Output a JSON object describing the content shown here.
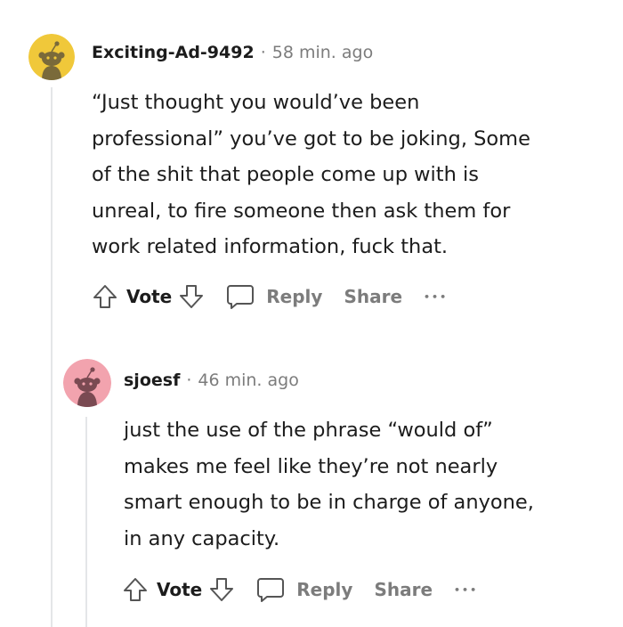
{
  "comments": [
    {
      "username": "Exciting-Ad-9492",
      "separator": "·",
      "time": "58 min. ago",
      "avatar_color": "#f0c83a",
      "body": "“Just thought you would’ve been\nprofessional” you’ve got to be joking, Some\nof the shit that people come up with is\nunreal, to fire someone then ask them for\nwork related information, fuck that.",
      "actions": {
        "vote_label": "Vote",
        "reply_label": "Reply",
        "share_label": "Share",
        "more_label": "•••"
      }
    },
    {
      "username": "sjoesf",
      "separator": "·",
      "time": "46 min. ago",
      "avatar_color": "#f2a3ae",
      "body": "just the use of the phrase “would of”\nmakes me feel like they’re not nearly\nsmart enough to be in charge of anyone,\nin any capacity.",
      "actions": {
        "vote_label": "Vote",
        "reply_label": "Reply",
        "share_label": "Share",
        "more_label": "•••"
      }
    }
  ],
  "icons": {
    "upvote": "upvote-arrow-icon",
    "downvote": "downvote-arrow-icon",
    "reply": "speech-bubble-icon",
    "avatar": "snoo-avatar-icon"
  },
  "colors": {
    "text": "#1c1c1c",
    "muted": "#7c7c7c",
    "thread_line": "#e4e6e8"
  }
}
